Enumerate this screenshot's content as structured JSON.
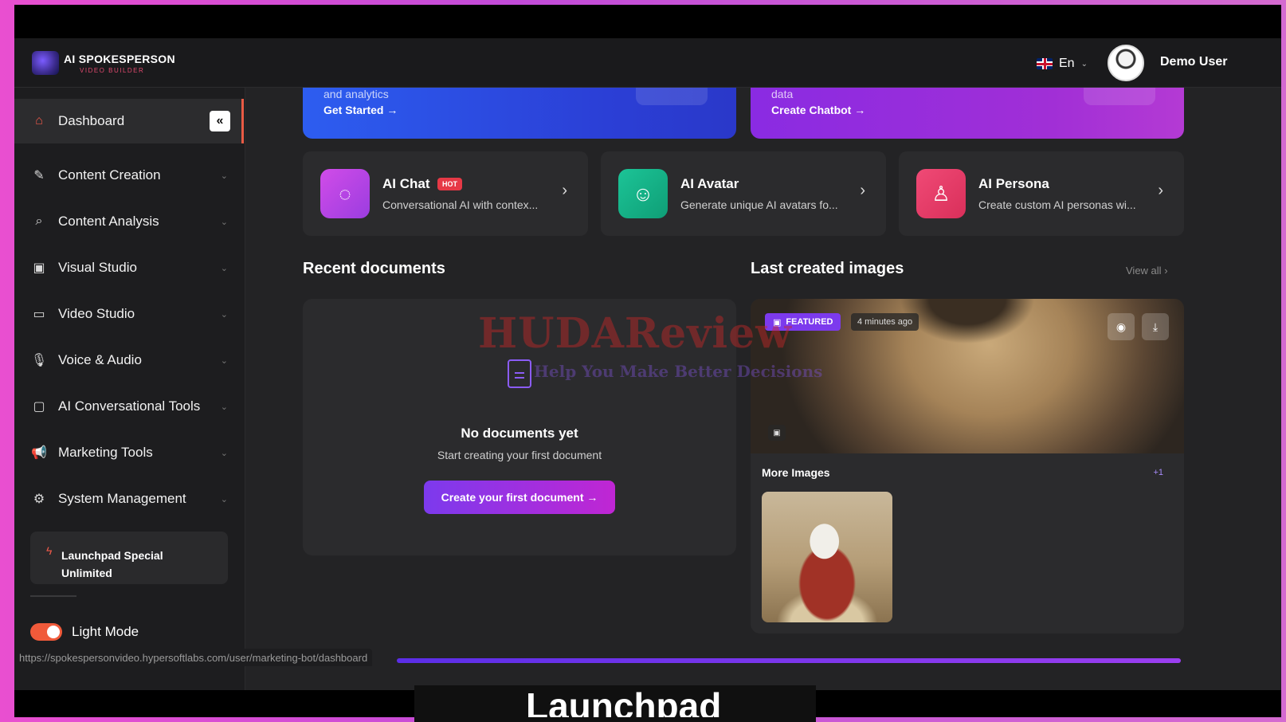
{
  "app": {
    "logo_title": "AI SPOKESPERSON",
    "logo_sub": "VIDEO BUILDER"
  },
  "header": {
    "language": "En",
    "username": "Demo User"
  },
  "sidebar": {
    "dashboard": "Dashboard",
    "items": [
      {
        "label": "Content Creation",
        "icon": "edit-icon"
      },
      {
        "label": "Content Analysis",
        "icon": "search-icon"
      },
      {
        "label": "Visual Studio",
        "icon": "image-icon"
      },
      {
        "label": "Video Studio",
        "icon": "video-icon"
      },
      {
        "label": "Voice & Audio",
        "icon": "microphone-icon"
      },
      {
        "label": "AI Conversational Tools",
        "icon": "chat-icon"
      },
      {
        "label": "Marketing Tools",
        "icon": "megaphone-icon"
      },
      {
        "label": "System Management",
        "icon": "gear-icon"
      }
    ],
    "plan": "Launchpad Special Unlimited",
    "light_mode": "Light Mode"
  },
  "banners": [
    {
      "text": "and analytics",
      "link": "Get Started →"
    },
    {
      "text": "data",
      "link": "Create Chatbot →"
    }
  ],
  "tools": [
    {
      "title": "AI Chat",
      "badge": "HOT",
      "desc": "Conversational AI with contex...",
      "color": "#c845e6"
    },
    {
      "title": "AI Avatar",
      "desc": "Generate unique AI avatars fo...",
      "color": "#16b58a"
    },
    {
      "title": "AI Persona",
      "desc": "Create custom AI personas wi...",
      "color": "#ec3f6a"
    }
  ],
  "recent_docs": {
    "title": "Recent documents",
    "empty_title": "No documents yet",
    "empty_sub": "Start creating your first document",
    "button": "Create your first document →"
  },
  "images": {
    "title": "Last created images",
    "view_all": "View all",
    "featured": "FEATURED",
    "time": "4 minutes ago",
    "more_title": "More Images",
    "more_count": "+1"
  },
  "watermark": {
    "main": "HUDAReview",
    "sub": "Help You Make Better Decisions"
  },
  "statusbar_url": "https://spokespersonvideo.hypersoftlabs.com/user/marketing-bot/dashboard",
  "bottom_overlay_text": "Launchpad"
}
